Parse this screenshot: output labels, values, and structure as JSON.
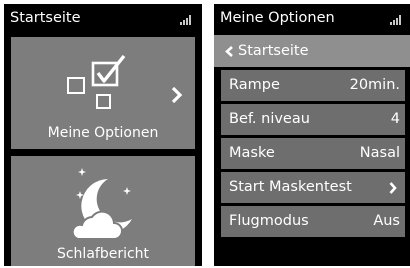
{
  "left_screen": {
    "title": "Startseite",
    "signal_icon": "signal-strength-icon",
    "tiles": [
      {
        "label": "Meine Optionen",
        "icon": "options-checkbox-icon",
        "chevron": "chevron-right-icon"
      },
      {
        "label": "Schlafbericht",
        "icon": "moon-cloud-stars-icon"
      }
    ]
  },
  "right_screen": {
    "title": "Meine Optionen",
    "signal_icon": "signal-strength-icon",
    "back": {
      "label": "Startseite",
      "icon": "chevron-left-icon"
    },
    "rows": [
      {
        "label": "Rampe",
        "value": "20min."
      },
      {
        "label": "Bef. niveau",
        "value": "4"
      },
      {
        "label": "Maske",
        "value": "Nasal"
      },
      {
        "label": "Start Maskentest",
        "icon": "chevron-right-icon"
      },
      {
        "label": "Flugmodus",
        "value": "Aus"
      }
    ]
  },
  "colors": {
    "screen_bg": "#000000",
    "tile_bg": "#7d7d7d",
    "back_row_bg": "#8f8f8f",
    "row_bg": "#6e6e6e",
    "text": "#ffffff"
  }
}
